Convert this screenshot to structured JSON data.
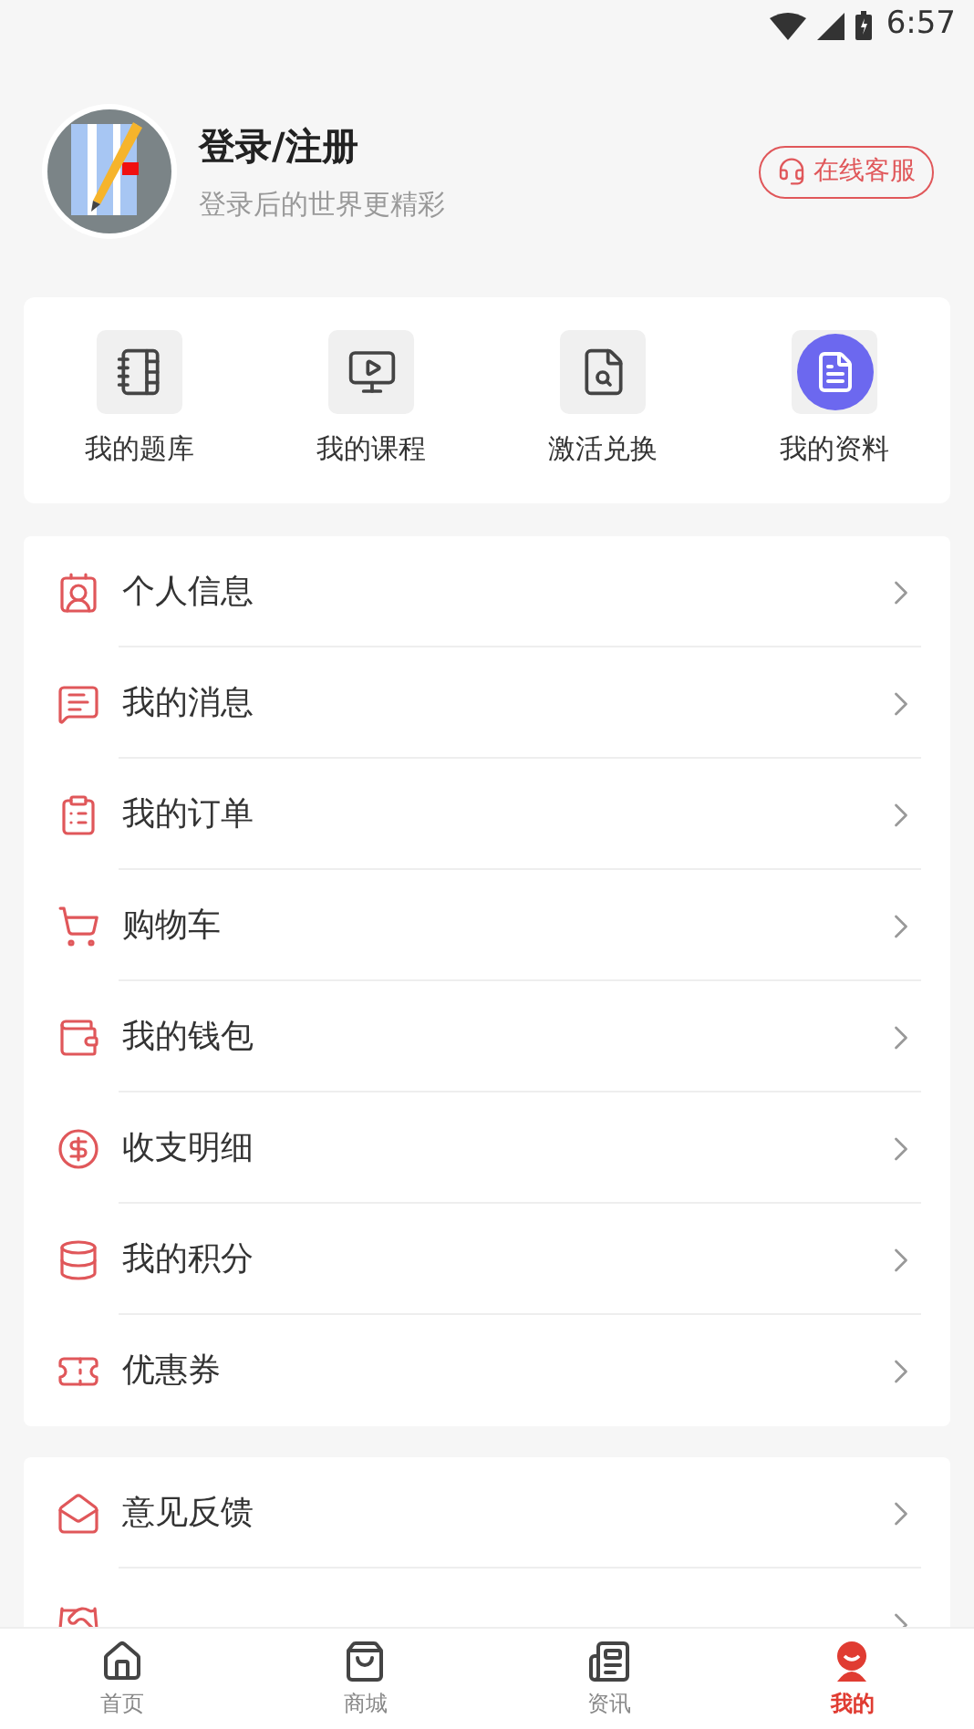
{
  "status_bar": {
    "time": "6:57"
  },
  "profile": {
    "title": "登录/注册",
    "subtitle": "登录后的世界更精彩",
    "service_button": "在线客服"
  },
  "shortcuts": [
    {
      "kind": "bank",
      "label": "我的题库"
    },
    {
      "kind": "course",
      "label": "我的课程"
    },
    {
      "kind": "activate",
      "label": "激活兑换"
    },
    {
      "kind": "material",
      "label": "我的资料"
    }
  ],
  "menu_groups": [
    [
      {
        "kind": "profile",
        "label": "个人信息"
      },
      {
        "kind": "message",
        "label": "我的消息"
      },
      {
        "kind": "order",
        "label": "我的订单"
      },
      {
        "kind": "cart",
        "label": "购物车"
      },
      {
        "kind": "wallet",
        "label": "我的钱包"
      },
      {
        "kind": "money",
        "label": "收支明细"
      },
      {
        "kind": "points",
        "label": "我的积分"
      },
      {
        "kind": "coupon",
        "label": "优惠券"
      }
    ],
    [
      {
        "kind": "feedback",
        "label": "意见反馈"
      },
      {
        "kind": "partner"
      }
    ]
  ],
  "tab_bar": [
    {
      "kind": "home",
      "label": "首页",
      "selected": false
    },
    {
      "kind": "shop",
      "label": "商城",
      "selected": false
    },
    {
      "kind": "news",
      "label": "资讯",
      "selected": false
    },
    {
      "kind": "me",
      "label": "我的",
      "selected": true
    }
  ]
}
